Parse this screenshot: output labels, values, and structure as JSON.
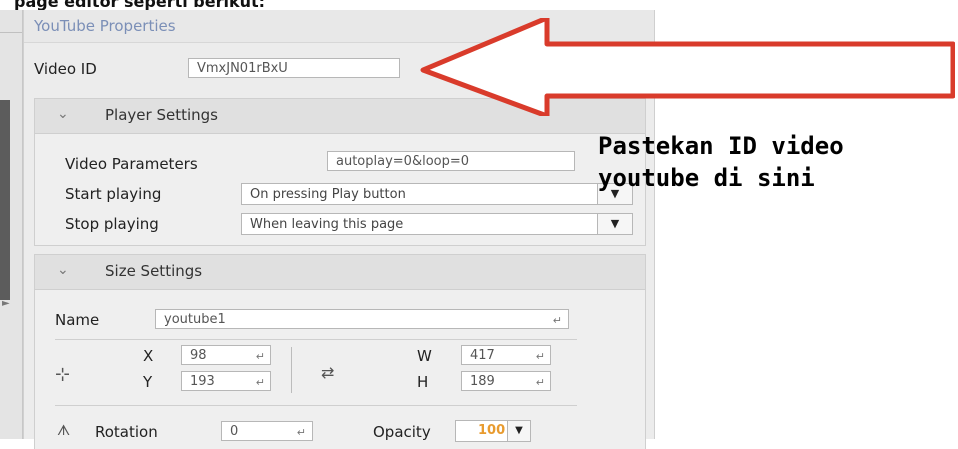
{
  "page": {
    "top_cutoff_text": "page editor seperti berikut:"
  },
  "panel": {
    "title": "YouTube Properties",
    "video_id_label": "Video ID",
    "video_id_value": "VmxJN01rBxU"
  },
  "player_settings": {
    "title": "Player Settings",
    "video_params_label": "Video Parameters",
    "video_params_value": "autoplay=0&loop=0",
    "start_playing_label": "Start playing",
    "start_playing_value": "On pressing Play button",
    "stop_playing_label": "Stop playing",
    "stop_playing_value": "When leaving this page"
  },
  "size_settings": {
    "title": "Size Settings",
    "name_label": "Name",
    "name_value": "youtube1",
    "x_label": "X",
    "x_value": "98",
    "y_label": "Y",
    "y_value": "193",
    "w_label": "W",
    "w_value": "417",
    "h_label": "H",
    "h_value": "189",
    "rotation_label": "Rotation",
    "rotation_value": "0",
    "opacity_label": "Opacity",
    "opacity_value": "100"
  },
  "annotation": {
    "line1": "Pastekan ID video",
    "line2": "youtube di sini"
  },
  "icons": {
    "enter": "enter-icon",
    "dropdown": "dropdown-icon",
    "chevron": "chevron-down-icon",
    "position": "move-icon",
    "size": "resize-icon",
    "rotation": "rotation-icon"
  },
  "colors": {
    "title_text": "#7b8fb7",
    "opacity_value": "#e89b2f",
    "annotation_arrow": "#d93b2b"
  }
}
